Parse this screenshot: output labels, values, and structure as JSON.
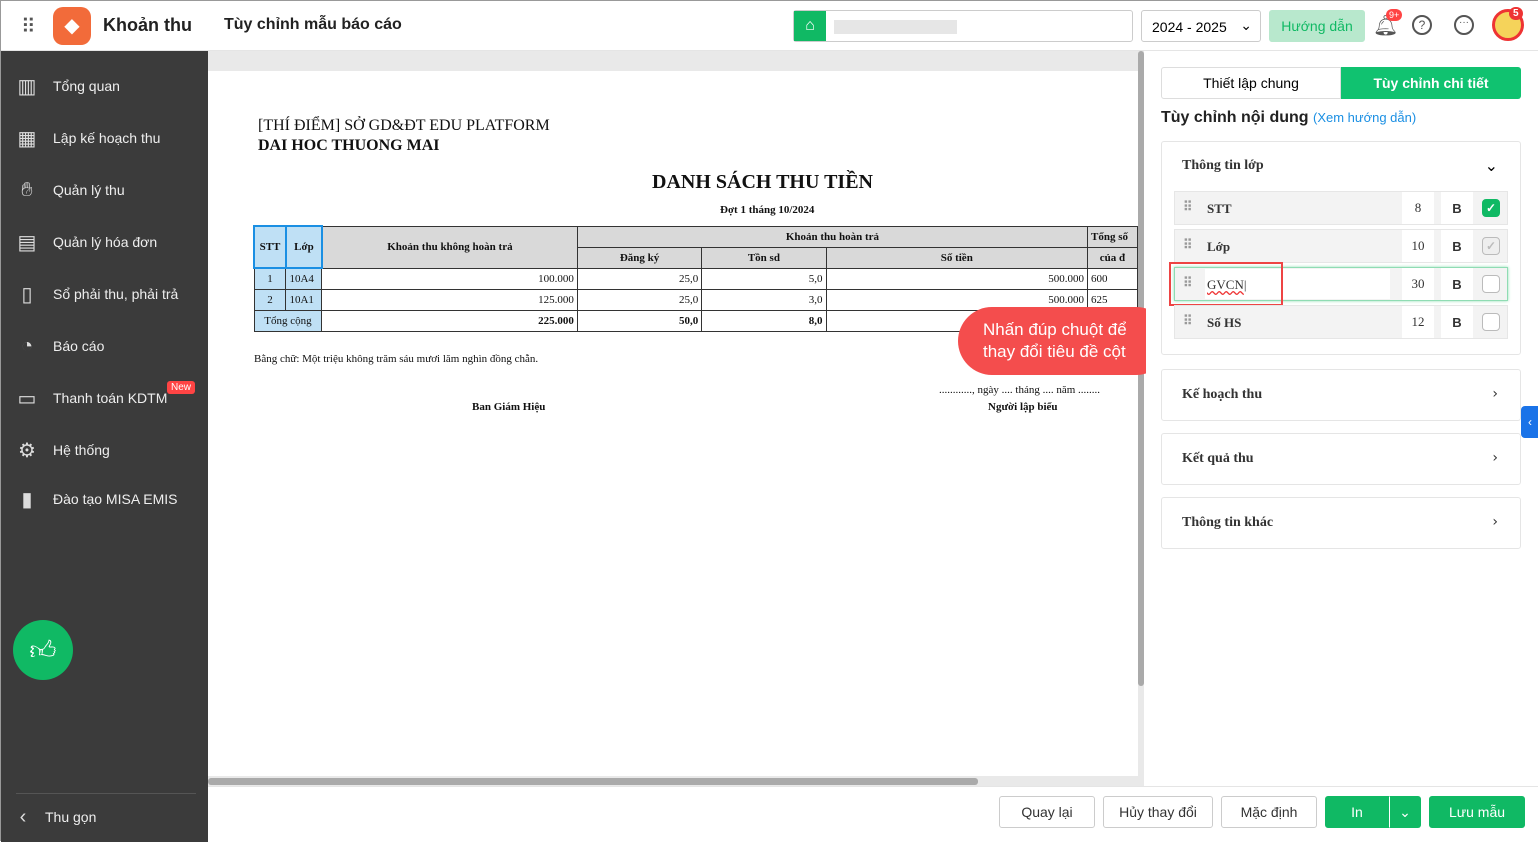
{
  "header": {
    "app_name": "Khoản thu",
    "page_title": "Tùy chỉnh mẫu báo cáo",
    "year": "2024 - 2025",
    "guide": "Hướng dẫn",
    "notif_badge": "9+",
    "avatar_badge": "5"
  },
  "sidebar": {
    "items": [
      {
        "label": "Tổng quan",
        "icon": "chart-icon"
      },
      {
        "label": "Lập kế hoạch thu",
        "icon": "calendar-money-icon"
      },
      {
        "label": "Quản lý thu",
        "icon": "hand-coin-icon"
      },
      {
        "label": "Quản lý hóa đơn",
        "icon": "invoice-icon"
      },
      {
        "label": "Sổ phải thu, phải trả",
        "icon": "ledger-icon"
      },
      {
        "label": "Báo cáo",
        "icon": "pie-icon"
      },
      {
        "label": "Thanh toán KDTM",
        "icon": "card-icon",
        "badge": "New"
      },
      {
        "label": "Hệ thống",
        "icon": "gear-icon"
      },
      {
        "label": "Đào tạo MISA EMIS",
        "icon": "book-icon"
      }
    ],
    "collapse": "Thu gọn"
  },
  "report": {
    "org1": "[THÍ ĐIỂM] SỞ GD&ĐT EDU PLATFORM",
    "org2": "DAI HOC THUONG MAI",
    "title": "DANH SÁCH THU TIỀN",
    "subtitle": "Đợt 1 tháng 10/2024",
    "headers": {
      "stt": "STT",
      "lop": "Lớp",
      "khong_hoan": "Khoản thu không hoàn trả",
      "hoan": "Khoản thu hoàn trả",
      "dang_ky": "Đăng ký",
      "ton_sd": "Tồn sd",
      "so_tien": "Số tiền",
      "tong_so": "Tổng số",
      "cua": "của đ"
    },
    "rows": [
      [
        "1",
        "10A4",
        "100.000",
        "25,0",
        "5,0",
        "500.000",
        "600"
      ],
      [
        "2",
        "10A1",
        "125.000",
        "25,0",
        "3,0",
        "500.000",
        "625"
      ]
    ],
    "total": {
      "label": "Tổng cộng",
      "khong_hoan": "225.000",
      "dang_ky": "50,0",
      "ton_sd": "8,0"
    },
    "words": "Bằng chữ: Một triệu không trăm sáu mươi lăm nghìn đồng chẵn.",
    "date": "............, ngày .... tháng .... năm ........",
    "sign_left": "Ban Giám Hiệu",
    "sign_right": "Người lập biểu"
  },
  "tooltip": "Nhấn đúp chuột để thay đổi tiêu đề cột",
  "panel": {
    "tabs": [
      "Thiết lập chung",
      "Tùy chỉnh chi tiết"
    ],
    "heading": "Tùy chỉnh nội dung",
    "guide_link": "(Xem hướng dẫn)",
    "section_open": "Thông tin lớp",
    "fields": [
      {
        "name": "STT",
        "width": "8",
        "bold": "B",
        "checked": true
      },
      {
        "name": "Lớp",
        "width": "10",
        "bold": "B",
        "checked": true
      },
      {
        "name": "GVCN",
        "width": "30",
        "bold": "B",
        "checked": false
      },
      {
        "name": "Số HS",
        "width": "12",
        "bold": "B",
        "checked": false
      }
    ],
    "sections": [
      "Kế hoạch thu",
      "Kết quả thu",
      "Thông tin khác"
    ]
  },
  "footer": {
    "back": "Quay lại",
    "undo": "Hủy thay đổi",
    "default": "Mặc định",
    "print": "In",
    "save": "Lưu mẫu"
  }
}
